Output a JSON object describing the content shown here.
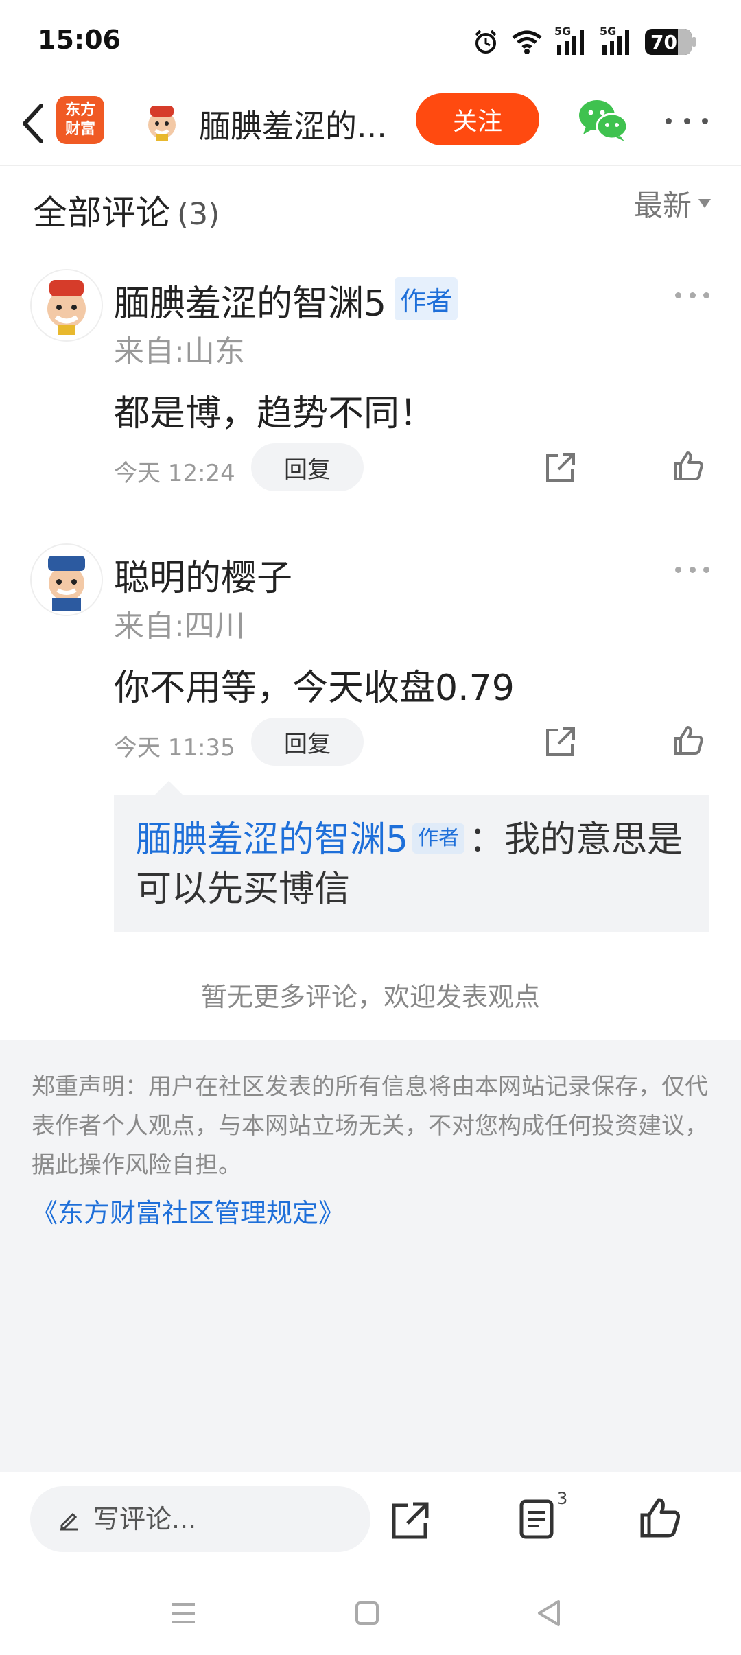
{
  "status_bar": {
    "time": "15:06",
    "battery": "70",
    "signal_label_1": "5G",
    "signal_label_2": "5G"
  },
  "header": {
    "app_logo_line1": "东方",
    "app_logo_line2": "财富",
    "title": "腼腆羞涩的...",
    "follow_label": "关注"
  },
  "comments_section": {
    "title": "全部评论",
    "count": "(3)",
    "sort_label": "最新"
  },
  "comments": [
    {
      "name": "腼腆羞涩的智渊5",
      "badge": "作者",
      "from": "来自:山东",
      "text": "都是博，趋势不同！",
      "time": "今天 12:24",
      "reply_label": "回复"
    },
    {
      "name": "聪明的樱子",
      "from": "来自:四川",
      "text": "你不用等，今天收盘0.79",
      "time": "今天 11:35",
      "reply_label": "回复"
    }
  ],
  "nested_reply": {
    "author": "腼腆羞涩的智渊5",
    "badge": "作者",
    "text": "：我的意思是可以先买博信"
  },
  "no_more_text": "暂无更多评论，欢迎发表观点",
  "disclaimer": {
    "text": "郑重声明：用户在社区发表的所有信息将由本网站记录保存，仅代表作者个人观点，与本网站立场无关，不对您构成任何投资建议，据此操作风险自担。",
    "link": "《东方财富社区管理规定》"
  },
  "bottom_bar": {
    "input_placeholder": "写评论...",
    "comment_count": "3"
  },
  "colors": {
    "accent": "#ff4a10",
    "link": "#1e6fd9",
    "app_logo": "#f05a24"
  },
  "icons": [
    "back-arrow-icon",
    "wechat-icon",
    "more-icon",
    "share-icon",
    "like-icon",
    "pencil-icon",
    "comments-icon",
    "menu-icon",
    "home-icon",
    "back-triangle-icon"
  ]
}
